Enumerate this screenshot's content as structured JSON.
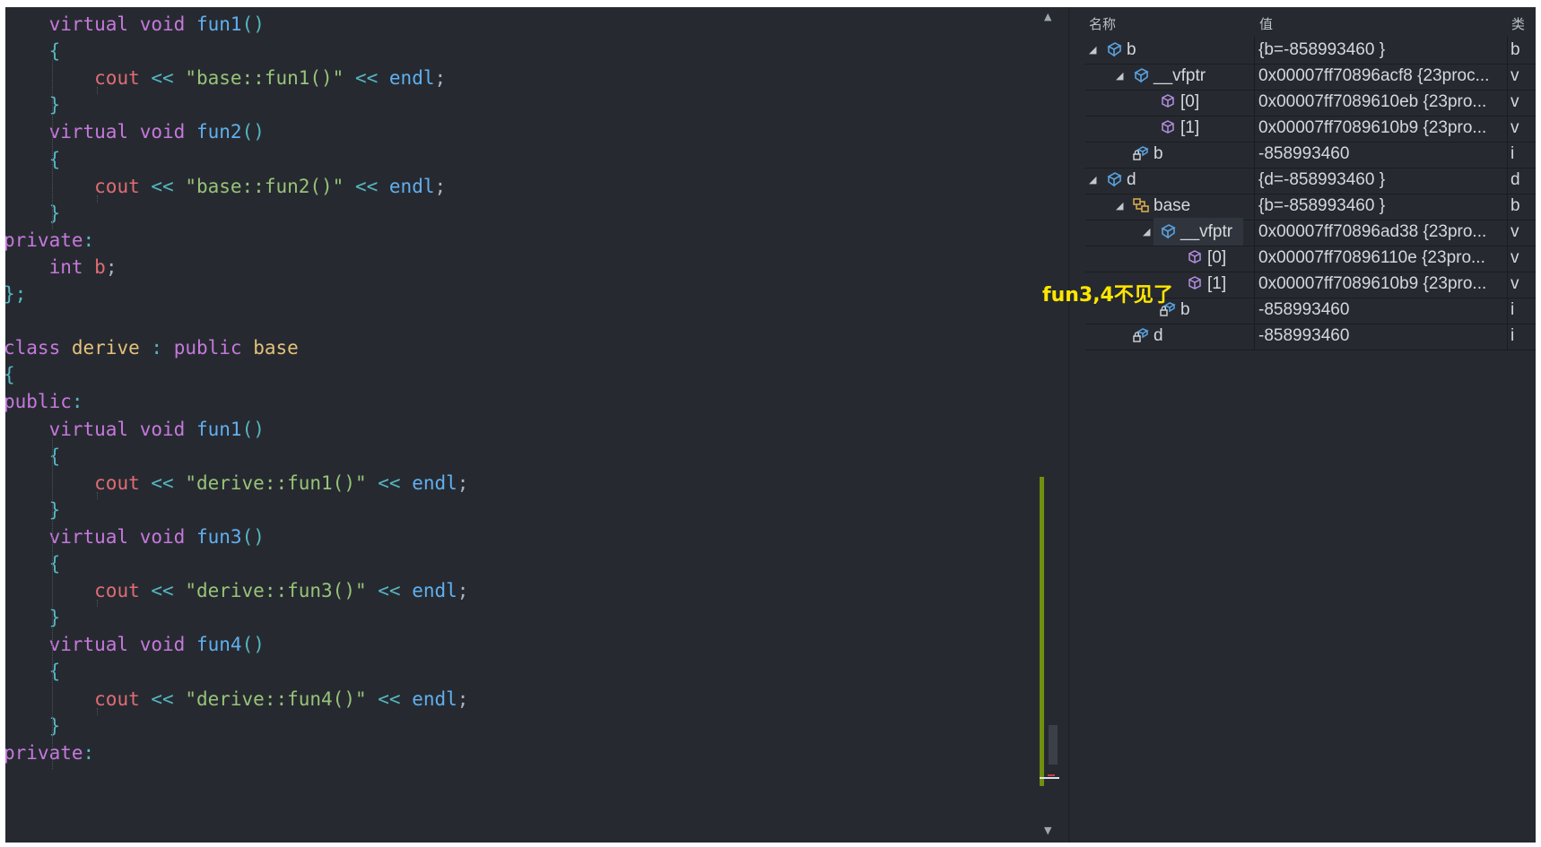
{
  "editor": {
    "lines": [
      [
        [
          "    ",
          "pun"
        ],
        [
          "virtual",
          "kw"
        ],
        [
          " ",
          "pun"
        ],
        [
          "void",
          "kw"
        ],
        [
          " ",
          "pun"
        ],
        [
          "fun1",
          "fn"
        ],
        [
          "()",
          "br"
        ]
      ],
      [
        [
          "    ",
          "pun"
        ],
        [
          "{",
          "br"
        ]
      ],
      [
        [
          "        ",
          "pun"
        ],
        [
          "cout",
          "var"
        ],
        [
          " << ",
          "op"
        ],
        [
          "\"base::fun1()\"",
          "str"
        ],
        [
          " << ",
          "op"
        ],
        [
          "endl",
          "fn"
        ],
        [
          ";",
          "pun"
        ]
      ],
      [
        [
          "    ",
          "pun"
        ],
        [
          "}",
          "br"
        ]
      ],
      [
        [
          "    ",
          "pun"
        ],
        [
          "virtual",
          "kw"
        ],
        [
          " ",
          "pun"
        ],
        [
          "void",
          "kw"
        ],
        [
          " ",
          "pun"
        ],
        [
          "fun2",
          "fn"
        ],
        [
          "()",
          "br"
        ]
      ],
      [
        [
          "    ",
          "pun"
        ],
        [
          "{",
          "br"
        ]
      ],
      [
        [
          "        ",
          "pun"
        ],
        [
          "cout",
          "var"
        ],
        [
          " << ",
          "op"
        ],
        [
          "\"base::fun2()\"",
          "str"
        ],
        [
          " << ",
          "op"
        ],
        [
          "endl",
          "fn"
        ],
        [
          ";",
          "pun"
        ]
      ],
      [
        [
          "    ",
          "pun"
        ],
        [
          "}",
          "br"
        ]
      ],
      [
        [
          "private",
          "kw"
        ],
        [
          ":",
          "op"
        ]
      ],
      [
        [
          "    ",
          "pun"
        ],
        [
          "int",
          "kw"
        ],
        [
          " ",
          "pun"
        ],
        [
          "b",
          "var"
        ],
        [
          ";",
          "pun"
        ]
      ],
      [
        [
          "};",
          "br"
        ]
      ],
      [],
      [
        [
          "class",
          "kw"
        ],
        [
          " ",
          "pun"
        ],
        [
          "derive",
          "cls"
        ],
        [
          " ",
          "pun"
        ],
        [
          ":",
          "op"
        ],
        [
          " ",
          "pun"
        ],
        [
          "public",
          "kw"
        ],
        [
          " ",
          "pun"
        ],
        [
          "base",
          "cls"
        ]
      ],
      [
        [
          "{",
          "br"
        ]
      ],
      [
        [
          "public",
          "kw"
        ],
        [
          ":",
          "op"
        ]
      ],
      [
        [
          "    ",
          "pun"
        ],
        [
          "virtual",
          "kw"
        ],
        [
          " ",
          "pun"
        ],
        [
          "void",
          "kw"
        ],
        [
          " ",
          "pun"
        ],
        [
          "fun1",
          "fn"
        ],
        [
          "()",
          "br"
        ]
      ],
      [
        [
          "    ",
          "pun"
        ],
        [
          "{",
          "br"
        ]
      ],
      [
        [
          "        ",
          "pun"
        ],
        [
          "cout",
          "var"
        ],
        [
          " << ",
          "op"
        ],
        [
          "\"derive::fun1()\"",
          "str"
        ],
        [
          " << ",
          "op"
        ],
        [
          "endl",
          "fn"
        ],
        [
          ";",
          "pun"
        ]
      ],
      [
        [
          "    ",
          "pun"
        ],
        [
          "}",
          "br"
        ]
      ],
      [
        [
          "    ",
          "pun"
        ],
        [
          "virtual",
          "kw"
        ],
        [
          " ",
          "pun"
        ],
        [
          "void",
          "kw"
        ],
        [
          " ",
          "pun"
        ],
        [
          "fun3",
          "fn"
        ],
        [
          "()",
          "br"
        ]
      ],
      [
        [
          "    ",
          "pun"
        ],
        [
          "{",
          "br"
        ]
      ],
      [
        [
          "        ",
          "pun"
        ],
        [
          "cout",
          "var"
        ],
        [
          " << ",
          "op"
        ],
        [
          "\"derive::fun3()\"",
          "str"
        ],
        [
          " << ",
          "op"
        ],
        [
          "endl",
          "fn"
        ],
        [
          ";",
          "pun"
        ]
      ],
      [
        [
          "    ",
          "pun"
        ],
        [
          "}",
          "br"
        ]
      ],
      [
        [
          "    ",
          "pun"
        ],
        [
          "virtual",
          "kw"
        ],
        [
          " ",
          "pun"
        ],
        [
          "void",
          "kw"
        ],
        [
          " ",
          "pun"
        ],
        [
          "fun4",
          "fn"
        ],
        [
          "()",
          "br"
        ]
      ],
      [
        [
          "    ",
          "pun"
        ],
        [
          "{",
          "br"
        ]
      ],
      [
        [
          "        ",
          "pun"
        ],
        [
          "cout",
          "var"
        ],
        [
          " << ",
          "op"
        ],
        [
          "\"derive::fun4()\"",
          "str"
        ],
        [
          " << ",
          "op"
        ],
        [
          "endl",
          "fn"
        ],
        [
          ";",
          "pun"
        ]
      ],
      [
        [
          "    ",
          "pun"
        ],
        [
          "}",
          "br"
        ]
      ],
      [
        [
          "private",
          "kw"
        ],
        [
          ":",
          "op"
        ]
      ]
    ]
  },
  "watch": {
    "headers": {
      "name": "名称",
      "value": "值",
      "type": "类"
    },
    "rows": [
      {
        "name": "b",
        "value": "{b=-858993460 }",
        "type": "b",
        "level": 0,
        "expanded": true,
        "icon": "object-icon"
      },
      {
        "name": "__vfptr",
        "value": "0x00007ff70896acf8 {23proc...",
        "type": "v",
        "level": 1,
        "expanded": true,
        "icon": "object-icon"
      },
      {
        "name": "[0]",
        "value": "0x00007ff7089610eb {23pro...",
        "type": "v",
        "level": 2,
        "expanded": false,
        "icon": "cube-icon"
      },
      {
        "name": "[1]",
        "value": "0x00007ff7089610b9 {23pro...",
        "type": "v",
        "level": 2,
        "expanded": false,
        "icon": "cube-icon"
      },
      {
        "name": "b",
        "value": "-858993460",
        "type": "i",
        "level": 1,
        "expanded": false,
        "icon": "private-field-icon"
      },
      {
        "name": "d",
        "value": "{d=-858993460 }",
        "type": "d",
        "level": 0,
        "expanded": true,
        "icon": "object-icon"
      },
      {
        "name": "base",
        "value": "{b=-858993460 }",
        "type": "b",
        "level": 1,
        "expanded": true,
        "icon": "base-class-icon"
      },
      {
        "name": "__vfptr",
        "value": "0x00007ff70896ad38 {23pro...",
        "type": "v",
        "level": 2,
        "expanded": true,
        "icon": "object-icon",
        "highlight": true
      },
      {
        "name": "[0]",
        "value": "0x00007ff70896110e {23pro...",
        "type": "v",
        "level": 3,
        "expanded": false,
        "icon": "cube-icon"
      },
      {
        "name": "[1]",
        "value": "0x00007ff7089610b9 {23pro...",
        "type": "v",
        "level": 3,
        "expanded": false,
        "icon": "cube-icon"
      },
      {
        "name": "b",
        "value": "-858993460",
        "type": "i",
        "level": 2,
        "expanded": false,
        "icon": "private-field-icon"
      },
      {
        "name": "d",
        "value": "-858993460",
        "type": "i",
        "level": 1,
        "expanded": false,
        "icon": "private-field-icon"
      }
    ]
  },
  "annotation": "fun3,4不见了",
  "scrollbar": {
    "up": "▲",
    "down": "▼"
  },
  "colors": {
    "background": "#262a30",
    "keyword": "#c678dd",
    "class": "#e5c07b",
    "function": "#61afef",
    "variable": "#e06c75",
    "string": "#98c379",
    "operator": "#56b6c2",
    "annotation": "#ffe600"
  }
}
